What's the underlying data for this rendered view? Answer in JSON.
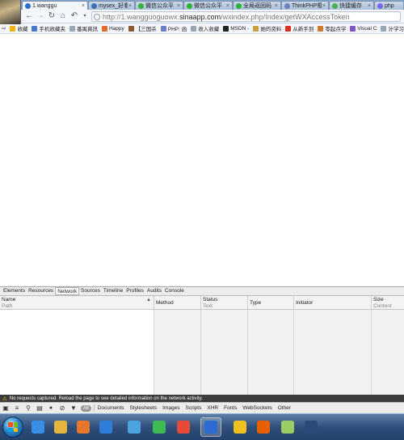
{
  "browser": {
    "tabs": [
      {
        "label": "1.wanggu",
        "active": true,
        "color": "#2a6fcf"
      },
      {
        "label": "mysex_好看",
        "active": false,
        "color": "#3a6fb6"
      },
      {
        "label": "微信公众平",
        "active": false,
        "color": "#2fb33a"
      },
      {
        "label": "微信公众平",
        "active": false,
        "color": "#2fb33a"
      },
      {
        "label": "全局返回码",
        "active": false,
        "color": "#2fb33a"
      },
      {
        "label": "ThinkPHP框",
        "active": false,
        "color": "#6b7fc3"
      },
      {
        "label": "快捷缓存",
        "active": false,
        "color": "#4caf50"
      },
      {
        "label": "php",
        "active": false,
        "color": "#7b68ee"
      }
    ],
    "url_host": "http://1.wangguoguowx.",
    "url_domain": "sinaapp.com",
    "url_path": "/wxindex.php/Index/getWXAccessToken",
    "bookmarks": [
      {
        "label": "收藏",
        "icon_color": "#f0b400"
      },
      {
        "label": "手机收藏夹",
        "icon_color": "#4a79c9"
      },
      {
        "label": "番禺資訊",
        "icon_color": "#9aa6b5"
      },
      {
        "label": "Happy",
        "icon_color": "#e46b2e"
      },
      {
        "label": "【三国杀",
        "icon_color": "#8b5a2b"
      },
      {
        "label": "PHP: 函",
        "icon_color": "#6b7fc3"
      },
      {
        "label": "收入收藏",
        "icon_color": "#9aa6b5"
      },
      {
        "label": "MSDN -",
        "icon_color": "#222222"
      },
      {
        "label": "她的资料",
        "icon_color": "#c9a040"
      },
      {
        "label": "从新手到",
        "icon_color": "#d93025"
      },
      {
        "label": "零起点学",
        "icon_color": "#d07a2c"
      },
      {
        "label": "Visual C",
        "icon_color": "#7e57c2"
      },
      {
        "label": "计学习",
        "icon_color": "#9aa6b5"
      }
    ]
  },
  "devtools": {
    "tabs": [
      "Elements",
      "Resources",
      "Network",
      "Sources",
      "Timeline",
      "Profiles",
      "Audits",
      "Console"
    ],
    "selected_tab": "Network",
    "columns": [
      {
        "title": "Name",
        "subtitle": "Path"
      },
      {
        "title": "Method",
        "subtitle": ""
      },
      {
        "title": "Status",
        "subtitle": "Text"
      },
      {
        "title": "Type",
        "subtitle": ""
      },
      {
        "title": "Initiator",
        "subtitle": ""
      },
      {
        "title": "Size",
        "subtitle": "Content"
      }
    ],
    "status_message": "No requests captured. Reload the page to see detailed information on the network activity.",
    "filter_all": "All",
    "filters": [
      "Documents",
      "Stylesheets",
      "Images",
      "Scripts",
      "XHR",
      "Fonts",
      "WebSockets",
      "Other"
    ]
  },
  "taskbar": {
    "apps": [
      {
        "name": "ie-icon",
        "color": "#3a8ee6"
      },
      {
        "name": "folder-icon",
        "color": "#e6b43a"
      },
      {
        "name": "media-player-icon",
        "color": "#e8762c"
      },
      {
        "name": "qq-icon",
        "color": "#2e7dd8"
      },
      {
        "name": "tool-icon",
        "color": "#4aa3df"
      },
      {
        "name": "browser-360-icon",
        "color": "#3cba54"
      },
      {
        "name": "app-icon",
        "color": "#e64a3a"
      },
      {
        "name": "edge-icon",
        "color": "#2c6bd1"
      },
      {
        "name": "chrome-icon",
        "color": "#f0c020"
      },
      {
        "name": "firefox-icon",
        "color": "#e66000"
      },
      {
        "name": "notepad-icon",
        "color": "#9ccc65"
      },
      {
        "name": "photoshop-icon",
        "color": "#2a4a7a"
      }
    ]
  }
}
